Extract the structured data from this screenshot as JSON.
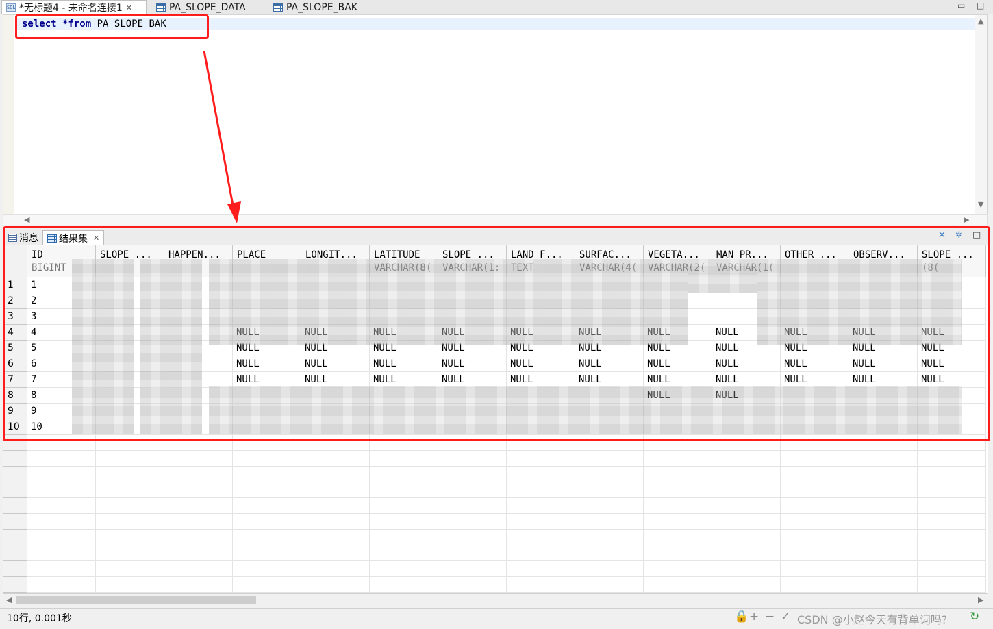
{
  "tabs": [
    {
      "label": "*无标题4 - 未命名连接1",
      "icon": "sql-file-icon",
      "active": true
    },
    {
      "label": "PA_SLOPE_DATA",
      "icon": "table-icon",
      "active": false
    },
    {
      "label": "PA_SLOPE_BAK",
      "icon": "table-icon",
      "active": false
    }
  ],
  "editor": {
    "keyword_select": "select",
    "from_kw": "*from",
    "table_name": "PA_SLOPE_BAK"
  },
  "results": {
    "tabs": [
      {
        "label": "消息",
        "icon": "message-icon"
      },
      {
        "label": "结果集",
        "icon": "grid-icon",
        "active": true
      }
    ],
    "columns": [
      {
        "name": "ID",
        "type": "BIGINT"
      },
      {
        "name": "SLOPE_...",
        "type": ""
      },
      {
        "name": "HAPPEN...",
        "type": ""
      },
      {
        "name": "PLACE",
        "type": ""
      },
      {
        "name": "LONGIT...",
        "type": ""
      },
      {
        "name": "LATITUDE",
        "type": "VARCHAR(8("
      },
      {
        "name": "SLOPE_...",
        "type": "VARCHAR(1:"
      },
      {
        "name": "LAND_F...",
        "type": "TEXT"
      },
      {
        "name": "SURFAC...",
        "type": "VARCHAR(4("
      },
      {
        "name": "VEGETA...",
        "type": "VARCHAR(2("
      },
      {
        "name": "MAN_PR...",
        "type": "VARCHAR(1("
      },
      {
        "name": "OTHER_...",
        "type": ""
      },
      {
        "name": "OBSERV...",
        "type": ""
      },
      {
        "name": "SLOPE_...",
        "type": "(8("
      }
    ],
    "row_numbers": [
      "1",
      "2",
      "3",
      "4",
      "5",
      "6",
      "7",
      "8",
      "9",
      "10"
    ],
    "id_values": [
      "1",
      "2",
      "3",
      "4",
      "5",
      "6",
      "7",
      "8",
      "9",
      "10"
    ],
    "null_label": "NULL"
  },
  "status": {
    "text": "10行, 0.001秒",
    "watermark": "CSDN @小赵今天有背单词吗?"
  },
  "colors": {
    "annotation_red": "#ff1c1c",
    "keyword_blue": "#00008b"
  }
}
